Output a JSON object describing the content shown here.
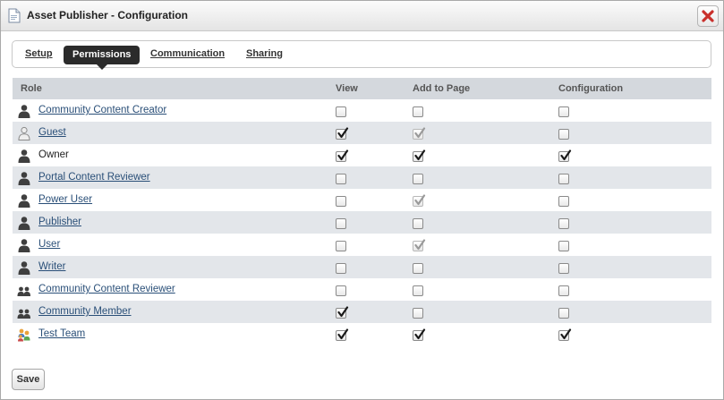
{
  "window": {
    "title": "Asset Publisher - Configuration",
    "title_icon": "document-icon",
    "close_icon": "close-icon"
  },
  "tabs": [
    {
      "label": "Setup",
      "active": false
    },
    {
      "label": "Permissions",
      "active": true
    },
    {
      "label": "Communication",
      "active": false
    },
    {
      "label": "Sharing",
      "active": false
    }
  ],
  "table": {
    "headers": [
      "Role",
      "View",
      "Add to Page",
      "Configuration"
    ],
    "rows": [
      {
        "role": "Community Content Creator",
        "icon": "user-icon",
        "link": true,
        "view": "unchecked",
        "add": "unchecked",
        "config": "unchecked"
      },
      {
        "role": "Guest",
        "icon": "guest-user-icon",
        "link": true,
        "view": "checked",
        "add": "checked-disabled",
        "config": "unchecked"
      },
      {
        "role": "Owner",
        "icon": "user-icon",
        "link": false,
        "view": "checked",
        "add": "checked",
        "config": "checked"
      },
      {
        "role": "Portal Content Reviewer",
        "icon": "user-icon",
        "link": true,
        "view": "unchecked",
        "add": "unchecked",
        "config": "unchecked"
      },
      {
        "role": "Power User",
        "icon": "user-icon",
        "link": true,
        "view": "unchecked",
        "add": "checked-disabled",
        "config": "unchecked"
      },
      {
        "role": "Publisher",
        "icon": "user-icon",
        "link": true,
        "view": "unchecked",
        "add": "unchecked",
        "config": "unchecked"
      },
      {
        "role": "User",
        "icon": "user-icon",
        "link": true,
        "view": "unchecked",
        "add": "checked-disabled",
        "config": "unchecked"
      },
      {
        "role": "Writer",
        "icon": "user-icon",
        "link": true,
        "view": "unchecked",
        "add": "unchecked",
        "config": "unchecked"
      },
      {
        "role": "Community Content Reviewer",
        "icon": "user-group-icon",
        "link": true,
        "view": "unchecked",
        "add": "unchecked",
        "config": "unchecked"
      },
      {
        "role": "Community Member",
        "icon": "user-group-icon",
        "link": true,
        "view": "checked",
        "add": "unchecked",
        "config": "unchecked"
      },
      {
        "role": "Test Team",
        "icon": "team-icon",
        "link": true,
        "view": "checked",
        "add": "checked",
        "config": "checked"
      }
    ]
  },
  "footer": {
    "save_label": "Save"
  },
  "colors": {
    "header_bg": "#d4d8dd",
    "alt_row_bg": "#e3e6ea",
    "active_tab_bg": "#2b2b2b",
    "close_red": "#c9302c",
    "link": "#2a4f78"
  }
}
